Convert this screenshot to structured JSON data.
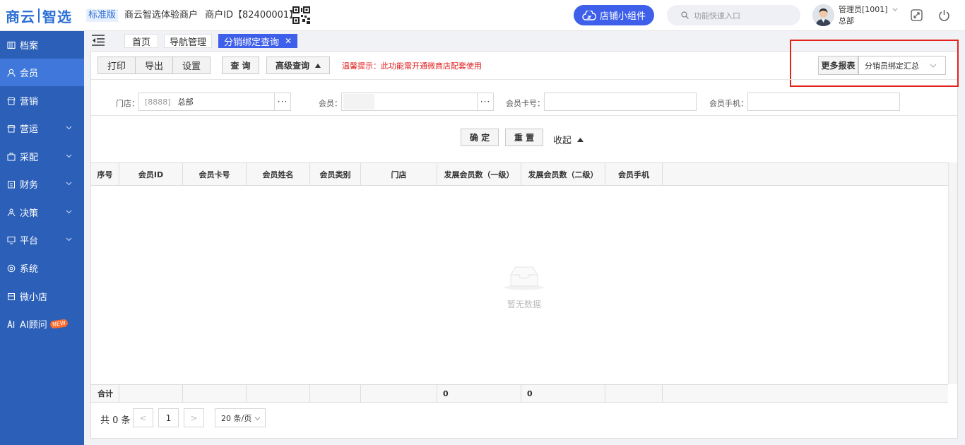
{
  "header": {
    "logo_left": "商云",
    "logo_right": "智选",
    "edition": "标准版",
    "merchant_name": "商云智选体验商户",
    "merchant_id": "商户ID【82400001】",
    "widget_button": "店铺小组件",
    "search_placeholder": "功能快速入口",
    "user_name": "管理员[1001]",
    "user_org": "总部"
  },
  "sidebar": {
    "items": [
      {
        "label": "档案",
        "icon": "archive-icon"
      },
      {
        "label": "会员",
        "icon": "user-icon"
      },
      {
        "label": "营销",
        "icon": "shop-icon"
      },
      {
        "label": "营运",
        "icon": "shop-icon"
      },
      {
        "label": "采配",
        "icon": "box-icon"
      },
      {
        "label": "财务",
        "icon": "finance-icon"
      },
      {
        "label": "决策",
        "icon": "decision-icon"
      },
      {
        "label": "平台",
        "icon": "monitor-icon"
      },
      {
        "label": "系统",
        "icon": "system-icon"
      },
      {
        "label": "微小店",
        "icon": "store-icon"
      },
      {
        "label": "AI顾问",
        "icon": "ai-icon",
        "tag": "NEW"
      }
    ]
  },
  "tabs": [
    {
      "label": "首页"
    },
    {
      "label": "导航管理"
    },
    {
      "label": "分销绑定查询",
      "close": "✕"
    }
  ],
  "toolbar": {
    "print": "打印",
    "export": "导出",
    "settings": "设置",
    "query": "查 询",
    "advanced": "高级查询",
    "tip": "温馨提示：此功能需开通微商店配套使用",
    "more_reports": "更多报表",
    "more_select_value": "分销员绑定汇总"
  },
  "filters": {
    "store_label": "门店：",
    "store_code": "[8888]",
    "store_name": "总部",
    "member_label": "会员：",
    "card_label": "会员卡号：",
    "phone_label": "会员手机：",
    "dots": "···"
  },
  "actions": {
    "confirm": "确 定",
    "reset": "重 置",
    "collapse": "收起"
  },
  "table": {
    "columns": [
      "序号",
      "会员ID",
      "会员卡号",
      "会员姓名",
      "会员类别",
      "门店",
      "发展会员数（一级）",
      "发展会员数（二级）",
      "会员手机"
    ],
    "empty_text": "暂无数据",
    "footer": {
      "label": "合计",
      "level1": "0",
      "level2": "0"
    }
  },
  "pagination": {
    "total": "共 0 条",
    "current_page": "1",
    "prev": "<",
    "next": ">",
    "page_size": "20 条/页"
  },
  "colors": {
    "primary": "#3d5fe9",
    "sidebar": "#2b5fb8",
    "sidebar_active": "#3f78da",
    "warning": "#e02020",
    "highlight_box": "#e3231c"
  }
}
